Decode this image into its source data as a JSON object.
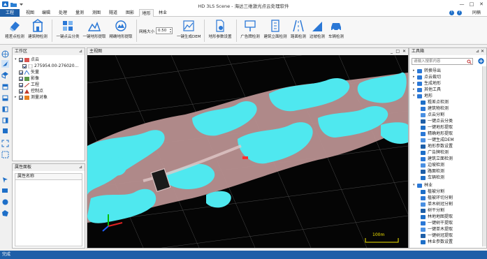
{
  "window": {
    "title": "HD 3LS Scene - 海达三维激光点云处理软件",
    "user": "同楠",
    "minimize": "—",
    "maximize": "□",
    "close": "✕"
  },
  "tabs": [
    {
      "label": "工程"
    },
    {
      "label": "视图"
    },
    {
      "label": "编辑"
    },
    {
      "label": "处理"
    },
    {
      "label": "量测"
    },
    {
      "label": "测图"
    },
    {
      "label": "隧道"
    },
    {
      "label": "图影"
    },
    {
      "label": "地形"
    },
    {
      "label": "林业"
    }
  ],
  "tab_help": {
    "info": "!",
    "help": "?"
  },
  "ribbon": {
    "b1": "粗差点检测",
    "b2": "建筑物检测",
    "b3": "一键点云分类",
    "b4": "一键地形提取",
    "b5": "精确地形提取",
    "grid_label": "网格大小",
    "grid_value": "0.50",
    "b6": "一键生成DEM",
    "b7": "地形参数设置",
    "b8": "广告牌检测",
    "b9": "建筑立面检测",
    "b10": "路面检测",
    "b11": "边坡检测",
    "b12": "车辆检测"
  },
  "workspace": {
    "title": "工作区",
    "pin": "⊿",
    "items": [
      {
        "label": "点云"
      },
      {
        "label": "275954.00-276020..."
      },
      {
        "label": "矢量"
      },
      {
        "label": "影像"
      },
      {
        "label": "工程"
      },
      {
        "label": "控制点"
      },
      {
        "label": "测量对象"
      }
    ]
  },
  "properties": {
    "title": "属性面板",
    "pin": "⊿",
    "col": "属性名称"
  },
  "main_view": {
    "title": "主视图",
    "min": "_",
    "max": "□",
    "close": "✕",
    "scale": "100m"
  },
  "toolbox": {
    "title": "工具箱",
    "pin": "⊿ ✕",
    "search_placeholder": "请输入搜索内容",
    "groups": [
      {
        "label": "转换导出"
      },
      {
        "label": "点云裁切"
      },
      {
        "label": "生成地形"
      },
      {
        "label": "其他工具"
      },
      {
        "label": "地形"
      }
    ],
    "terrain_items": [
      {
        "label": "粗差点检测"
      },
      {
        "label": "建筑物检测"
      },
      {
        "label": "点云分割"
      },
      {
        "label": "一键点云分类"
      },
      {
        "label": "一键地形提取"
      },
      {
        "label": "精确地形提取"
      },
      {
        "label": "一键生成DEM"
      },
      {
        "label": "地形参数设置"
      },
      {
        "label": "广告牌检测"
      },
      {
        "label": "建筑立面检测"
      },
      {
        "label": "边坡检测"
      },
      {
        "label": "路面检测"
      },
      {
        "label": "车辆检测"
      }
    ],
    "forestry_group": "林业",
    "forestry_items": [
      {
        "label": "植被分割"
      },
      {
        "label": "植被环切分割"
      },
      {
        "label": "单木树冠分割"
      },
      {
        "label": "树干分割"
      },
      {
        "label": "林地地图提取"
      },
      {
        "label": "一键树干提取"
      },
      {
        "label": "一键单木提取"
      },
      {
        "label": "一键树冠提取"
      },
      {
        "label": "林业参数设置"
      }
    ]
  },
  "status": {
    "text": "完成"
  },
  "colors": {
    "accent": "#1e5fa8",
    "cloud_cyan": "#4fe8ef",
    "cloud_pink": "#c89a9a",
    "viewport_bg": "#050505"
  }
}
